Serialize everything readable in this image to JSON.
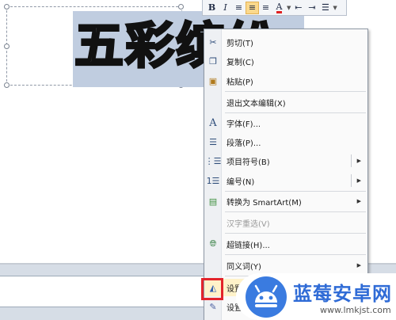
{
  "slide": {
    "text": "五彩缤纷"
  },
  "mini_toolbar": {
    "buttons": [
      {
        "name": "bold",
        "label": "B"
      },
      {
        "name": "italic",
        "label": "I"
      },
      {
        "name": "align-left",
        "label": "≡"
      },
      {
        "name": "align-center",
        "label": "≡",
        "active": true
      },
      {
        "name": "align-right",
        "label": "≡"
      },
      {
        "name": "font-color",
        "label": "A"
      },
      {
        "name": "decrease-indent",
        "label": "⇤"
      },
      {
        "name": "increase-indent",
        "label": "⇥"
      },
      {
        "name": "bullets",
        "label": "☰"
      }
    ]
  },
  "context_menu": {
    "items": [
      {
        "label": "剪切(T)",
        "icon": "scissors-icon"
      },
      {
        "label": "复制(C)",
        "icon": "copy-icon"
      },
      {
        "label": "粘贴(P)",
        "icon": "paste-icon"
      },
      {
        "label": "退出文本编辑(X)",
        "icon": ""
      },
      {
        "label": "字体(F)...",
        "icon": "font-icon"
      },
      {
        "label": "段落(P)...",
        "icon": "paragraph-icon"
      },
      {
        "label": "项目符号(B)",
        "icon": "bullets-icon",
        "submenu": true
      },
      {
        "label": "编号(N)",
        "icon": "numbering-icon",
        "submenu": true
      },
      {
        "label": "转换为 SmartArt(M)",
        "icon": "smartart-icon",
        "submenu": true
      },
      {
        "label": "汉字重选(V)",
        "icon": "",
        "disabled": true
      },
      {
        "label": "超链接(H)...",
        "icon": "hyperlink-icon"
      },
      {
        "label": "同义词(Y)",
        "icon": "",
        "submenu": true
      },
      {
        "label": "设置",
        "icon": "format-shape-icon",
        "highlight": true
      },
      {
        "label": "设置",
        "icon": "format-text-effects-icon"
      }
    ]
  },
  "watermark": {
    "title": "蓝莓安卓网",
    "url": "www.lmkjst.com",
    "colors": {
      "brand": "#2f6bd6"
    }
  },
  "colors": {
    "selection": "#c0cde0",
    "highlight_border": "#e3242b",
    "menu_hover": "#fff2c9"
  }
}
